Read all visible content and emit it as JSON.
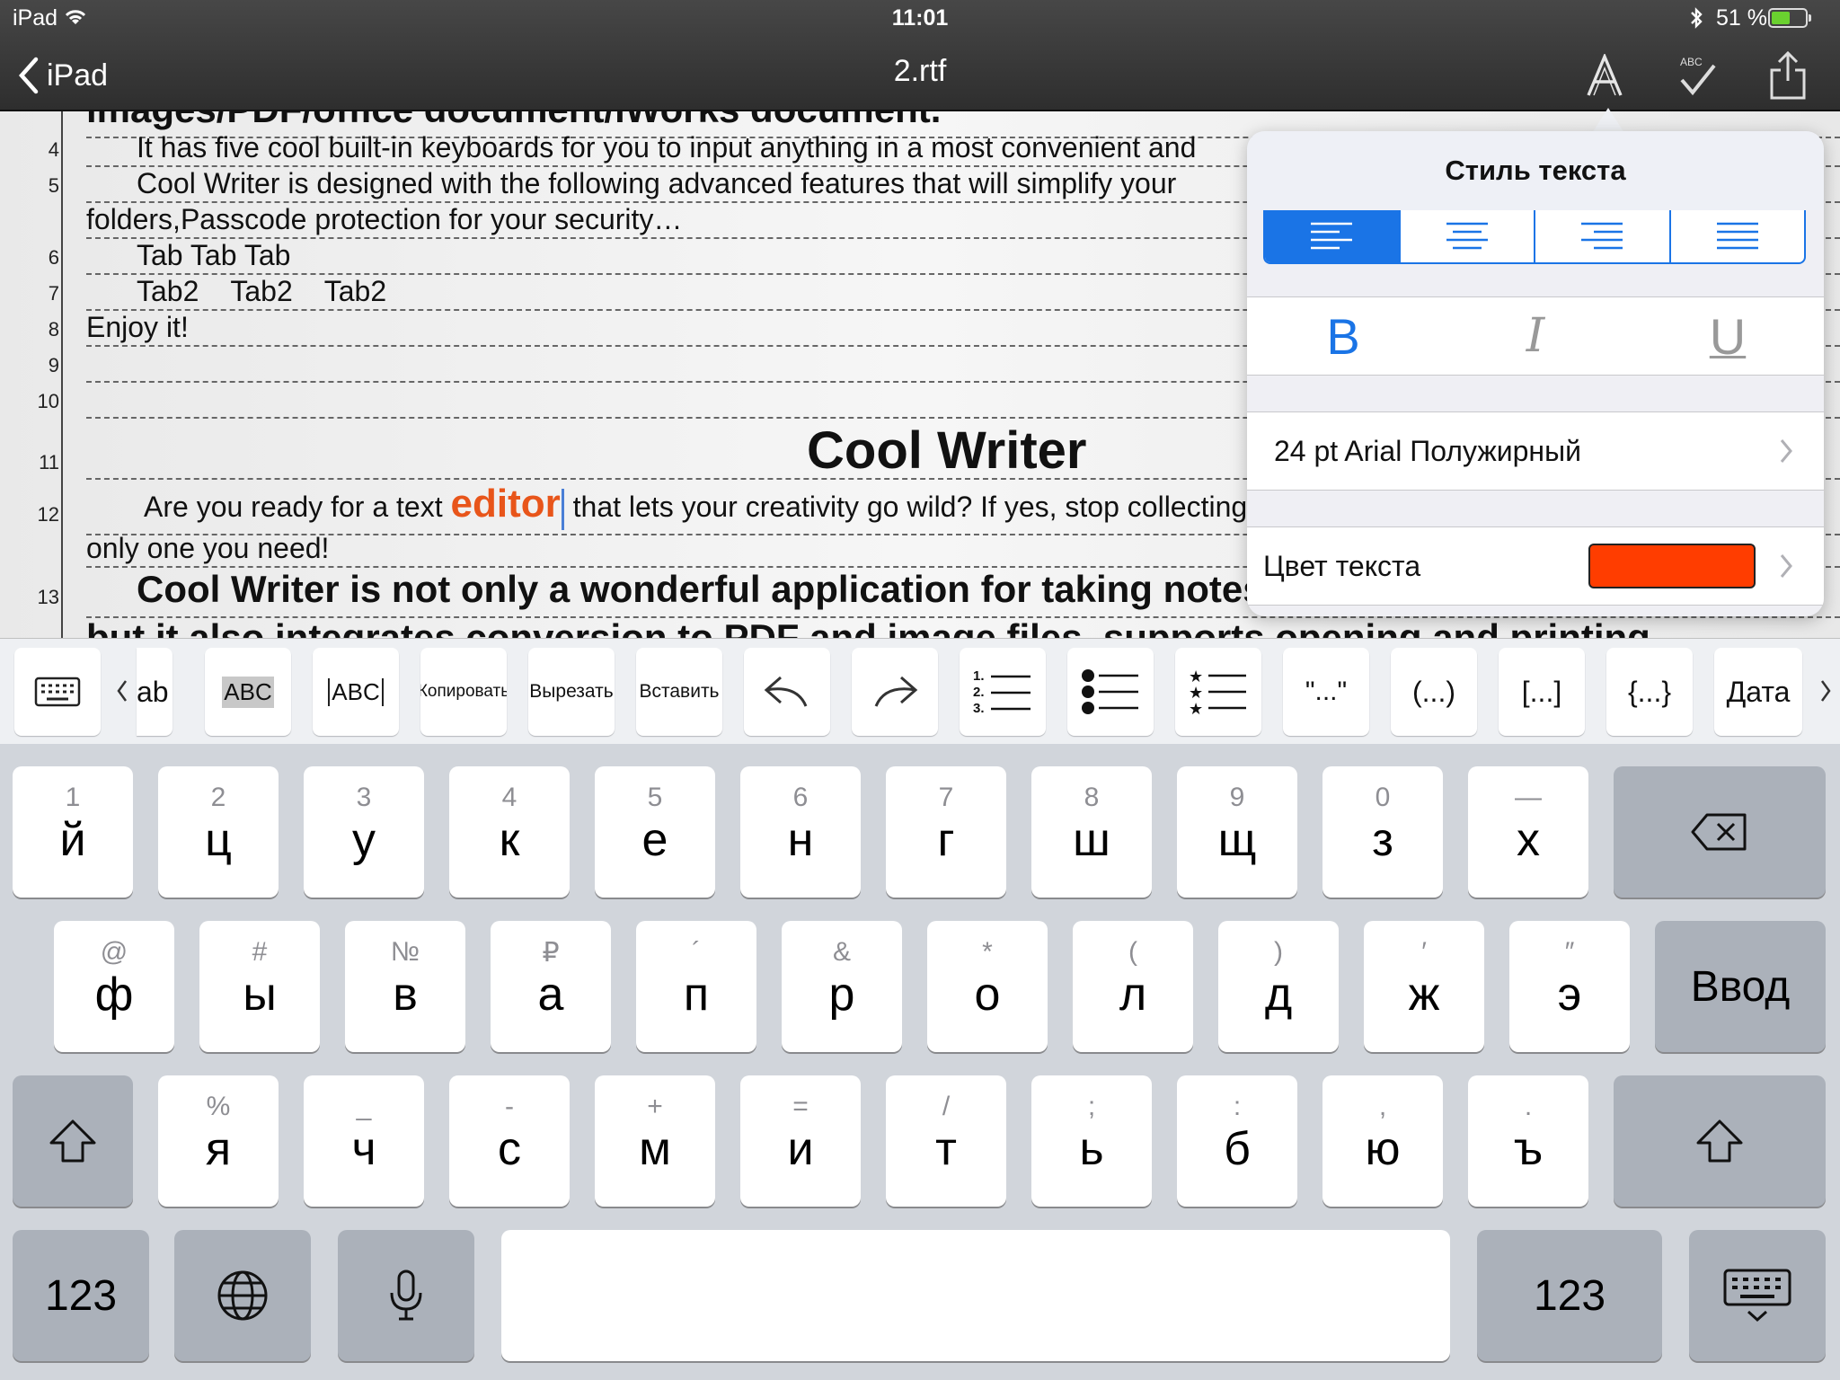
{
  "status_bar": {
    "device": "iPad",
    "time": "11:01",
    "battery": "51 %"
  },
  "nav": {
    "back_label": "iPad",
    "title": "2.rtf"
  },
  "document": {
    "clipped_top": "images/PDF/office document/iWorks document.",
    "line_numbers": [
      "4",
      "5",
      "6",
      "7",
      "8",
      "9",
      "10",
      "11",
      "12",
      "13"
    ],
    "lines": {
      "l4": "It has five cool built-in keyboards for you to input anything in a most convenient and",
      "l5": "Cool Writer is designed with the following advanced features that will simplify your",
      "l5b": "folders,Passcode protection for your security…",
      "l6": "Tab Tab Tab",
      "l7": "Tab2    Tab2    Tab2",
      "l8": "Enjoy it!",
      "l11": "Cool Writer",
      "l12a": "Are you ready for a text ",
      "l12_highlight": "editor",
      "l12b": " that lets your creativity go wild? If yes, stop collecting",
      "l12c": "only one you need!",
      "l13": "Cool Writer is not only a wonderful application for taking notes,",
      "l13b": "but it also integrates conversion to PDF and image files, supports opening and printing"
    }
  },
  "style_popover": {
    "title": "Стиль текста",
    "bold": "B",
    "italic": "I",
    "underline": "U",
    "font": "24 pt Arial Полужирный",
    "color_label": "Цвет текста",
    "color_value": "#ff3d00",
    "accent": "#1a74e6"
  },
  "toolbar": {
    "tab": "ab",
    "abc": "ABC",
    "copy": "Копировать",
    "cut": "Вырезать",
    "paste": "Вставить",
    "quotes": "\"...\"",
    "parens": "(...)",
    "brackets": "[...]",
    "braces": "{...}",
    "date": "Дата"
  },
  "keyboard": {
    "row1": [
      {
        "hint": "1",
        "key": "й"
      },
      {
        "hint": "2",
        "key": "ц"
      },
      {
        "hint": "3",
        "key": "у"
      },
      {
        "hint": "4",
        "key": "к"
      },
      {
        "hint": "5",
        "key": "е"
      },
      {
        "hint": "6",
        "key": "н"
      },
      {
        "hint": "7",
        "key": "г"
      },
      {
        "hint": "8",
        "key": "ш"
      },
      {
        "hint": "9",
        "key": "щ"
      },
      {
        "hint": "0",
        "key": "з"
      },
      {
        "hint": "—",
        "key": "х"
      }
    ],
    "row2": [
      {
        "hint": "@",
        "key": "ф"
      },
      {
        "hint": "#",
        "key": "ы"
      },
      {
        "hint": "№",
        "key": "в"
      },
      {
        "hint": "₽",
        "key": "а"
      },
      {
        "hint": "´",
        "key": "п"
      },
      {
        "hint": "&",
        "key": "р"
      },
      {
        "hint": "*",
        "key": "о"
      },
      {
        "hint": "(",
        "key": "л"
      },
      {
        "hint": ")",
        "key": "д"
      },
      {
        "hint": "′",
        "key": "ж"
      },
      {
        "hint": "″",
        "key": "э"
      }
    ],
    "row3": [
      {
        "hint": "%",
        "key": "я"
      },
      {
        "hint": "_",
        "key": "ч"
      },
      {
        "hint": "-",
        "key": "с"
      },
      {
        "hint": "+",
        "key": "м"
      },
      {
        "hint": "=",
        "key": "и"
      },
      {
        "hint": "/",
        "key": "т"
      },
      {
        "hint": ";",
        "key": "ь"
      },
      {
        "hint": ":",
        "key": "б"
      },
      {
        "hint": ",",
        "key": "ю"
      },
      {
        "hint": ".",
        "key": "ъ"
      }
    ],
    "return": "Ввод",
    "numbers": "123"
  }
}
